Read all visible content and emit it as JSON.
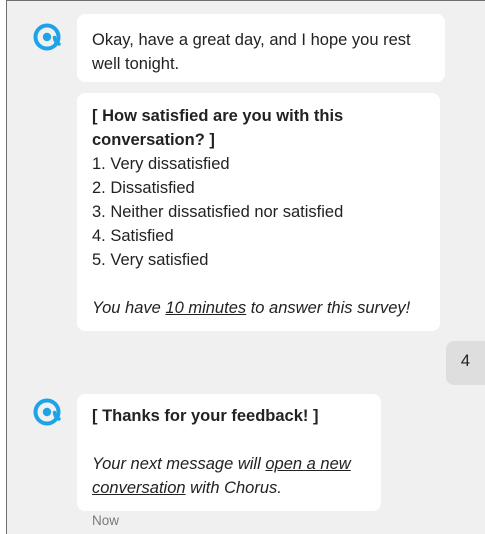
{
  "messages": {
    "farewell": "Okay, have a great day, and I hope you rest well tonight.",
    "survey": {
      "title": "[ How satisfied are you with this conversation? ]",
      "options": [
        "1. Very dissatisfied",
        "2. Dissatisfied",
        "3. Neither dissatisfied nor satisfied",
        "4. Satisfied",
        "5. Very satisfied"
      ],
      "footer_prefix": "You have ",
      "footer_link": "10 minutes",
      "footer_suffix": " to answer this survey!"
    },
    "user_reply": "4",
    "thanks": {
      "title": "[ Thanks for your feedback! ]",
      "body_prefix": "Your next message will ",
      "body_link": "open a new conversation",
      "body_suffix": " with Chorus."
    },
    "timestamp": "Now"
  },
  "colors": {
    "bot_icon": "#1fa3e8",
    "background": "#f0f0f0",
    "bubble": "#ffffff",
    "user_bubble": "#dedede"
  },
  "icons": {
    "bot_avatar": "chorus-logo-icon"
  }
}
